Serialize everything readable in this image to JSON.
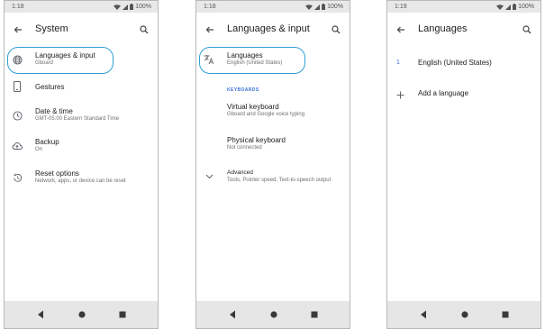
{
  "screens": [
    {
      "status": {
        "time": "1:18",
        "battery": "100%"
      },
      "title": "System",
      "items": [
        {
          "title": "Languages & input",
          "subtitle": "Gboard",
          "icon": "globe-icon"
        },
        {
          "title": "Gestures",
          "icon": "phone-gesture-icon"
        },
        {
          "title": "Date & time",
          "subtitle": "GMT-05:00 Eastern Standard Time",
          "icon": "clock-icon"
        },
        {
          "title": "Backup",
          "subtitle": "On",
          "icon": "cloud-upload-icon"
        },
        {
          "title": "Reset options",
          "subtitle": "Network, apps, or device can be reset",
          "icon": "history-icon"
        }
      ]
    },
    {
      "status": {
        "time": "1:18",
        "battery": "100%"
      },
      "title": "Languages & input",
      "languages": {
        "title": "Languages",
        "subtitle": "English (United States)",
        "icon": "translate-icon"
      },
      "section_header": "KEYBOARDS",
      "items": [
        {
          "title": "Virtual keyboard",
          "subtitle": "Gboard and Google voice typing"
        },
        {
          "title": "Physical keyboard",
          "subtitle": "Not connected"
        },
        {
          "title": "Advanced",
          "subtitle": "Tools, Pointer speed, Text-to-speech output",
          "icon": "chevron-down-icon"
        }
      ]
    },
    {
      "status": {
        "time": "1:19",
        "battery": "100%"
      },
      "title": "Languages",
      "languages": [
        {
          "number": "1",
          "name": "English (United States)"
        }
      ],
      "add_language": "Add a language"
    }
  ],
  "colors": {
    "accent": "#3c6fd8",
    "highlight_ring": "#2e9fd4",
    "status_bar": "#e8e8e8",
    "nav_bar": "#e6e6e6",
    "icon": "#5f6368"
  }
}
